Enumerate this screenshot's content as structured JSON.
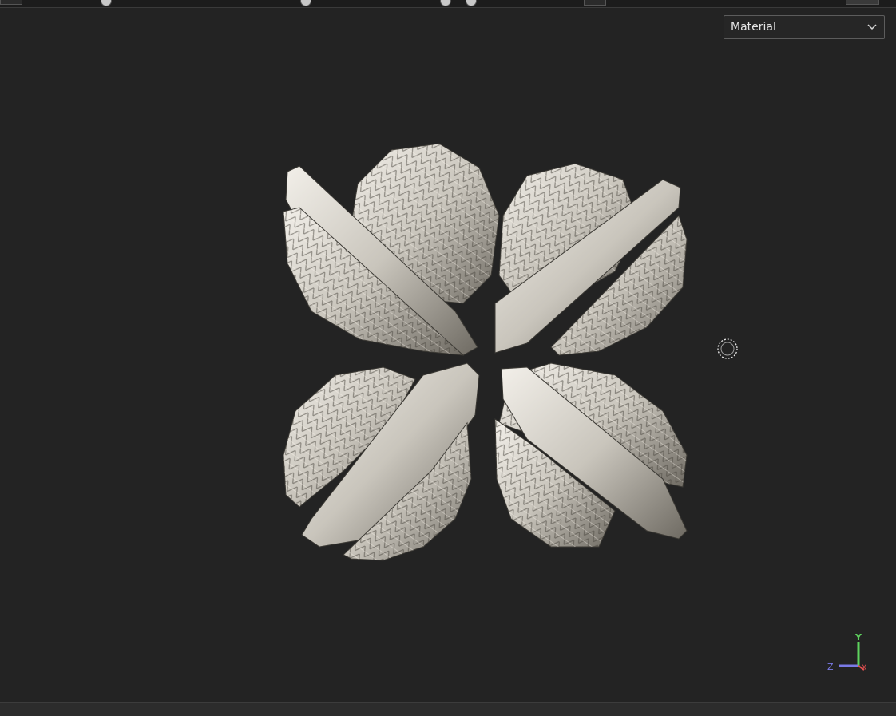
{
  "viewport": {
    "shading_select": {
      "value": "Material"
    }
  },
  "axis_gizmo": {
    "y_label": "Y",
    "z_label": "Z",
    "x_label": "X",
    "colors": {
      "y": "#5ed35e",
      "z": "#7a7ae6",
      "x": "#e05050"
    }
  },
  "colors": {
    "background": "#232323",
    "mesh_light": "#e2ded6",
    "mesh_dark": "#6e6a62"
  },
  "icons": {
    "select_arrow": "chevron-down-icon",
    "brush_cursor": "brush-cursor-icon"
  }
}
